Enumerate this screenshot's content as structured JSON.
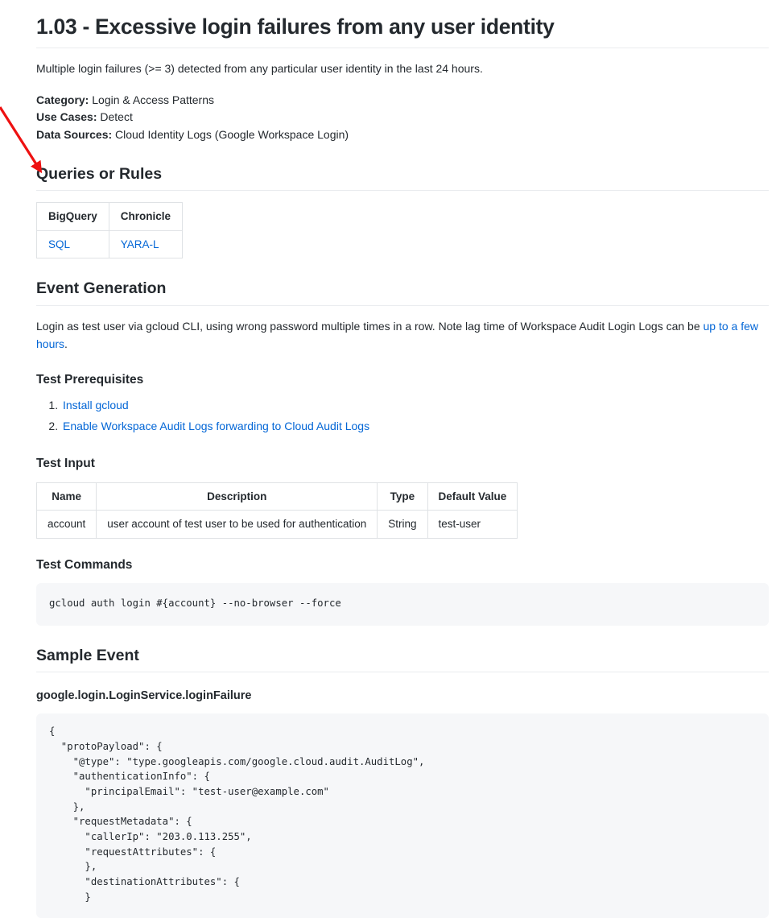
{
  "document": {
    "title": "1.03 - Excessive login failures from any user identity",
    "description": "Multiple login failures (>= 3) detected from any particular user identity in the last 24 hours.",
    "metadata": [
      {
        "label": "Category:",
        "value": " Login & Access Patterns"
      },
      {
        "label": "Use Cases:",
        "value": " Detect"
      },
      {
        "label": "Data Sources:",
        "value": " Cloud Identity Logs (Google Workspace Login)"
      }
    ]
  },
  "queries_section": {
    "heading": "Queries or Rules",
    "table": {
      "headers": [
        "BigQuery",
        "Chronicle"
      ],
      "rows": [
        [
          "SQL",
          "YARA-L"
        ]
      ]
    }
  },
  "event_generation": {
    "heading": "Event Generation",
    "intro_text_part1": "Login as test user via gcloud CLI, using wrong password multiple times in a row. Note lag time of Workspace Audit Login Logs can be ",
    "intro_link": "up to a few hours",
    "intro_text_part2": ".",
    "prerequisites": {
      "heading": "Test Prerequisites",
      "items": [
        "Install gcloud",
        "Enable Workspace Audit Logs forwarding to Cloud Audit Logs"
      ]
    },
    "test_input": {
      "heading": "Test Input",
      "headers": [
        "Name",
        "Description",
        "Type",
        "Default Value"
      ],
      "rows": [
        [
          "account",
          "user account of test user to be used for authentication",
          "String",
          "test-user"
        ]
      ]
    },
    "test_commands": {
      "heading": "Test Commands",
      "command": "gcloud auth login #{account} --no-browser --force"
    }
  },
  "sample_event": {
    "heading": "Sample Event",
    "event_name": "google.login.LoginService.loginFailure",
    "json": "{\n  \"protoPayload\": {\n    \"@type\": \"type.googleapis.com/google.cloud.audit.AuditLog\",\n    \"authenticationInfo\": {\n      \"principalEmail\": \"test-user@example.com\"\n    },\n    \"requestMetadata\": {\n      \"callerIp\": \"203.0.113.255\",\n      \"requestAttributes\": {\n      },\n      \"destinationAttributes\": {\n      }"
  },
  "annotation": {
    "arrow_color": "#ee1111",
    "points_at": "Queries or Rules"
  },
  "colors": {
    "link": "#0366d6",
    "text": "#24292e",
    "rule": "#eaecef",
    "table_border": "#dfe2e5",
    "code_background": "#f6f7f9"
  }
}
